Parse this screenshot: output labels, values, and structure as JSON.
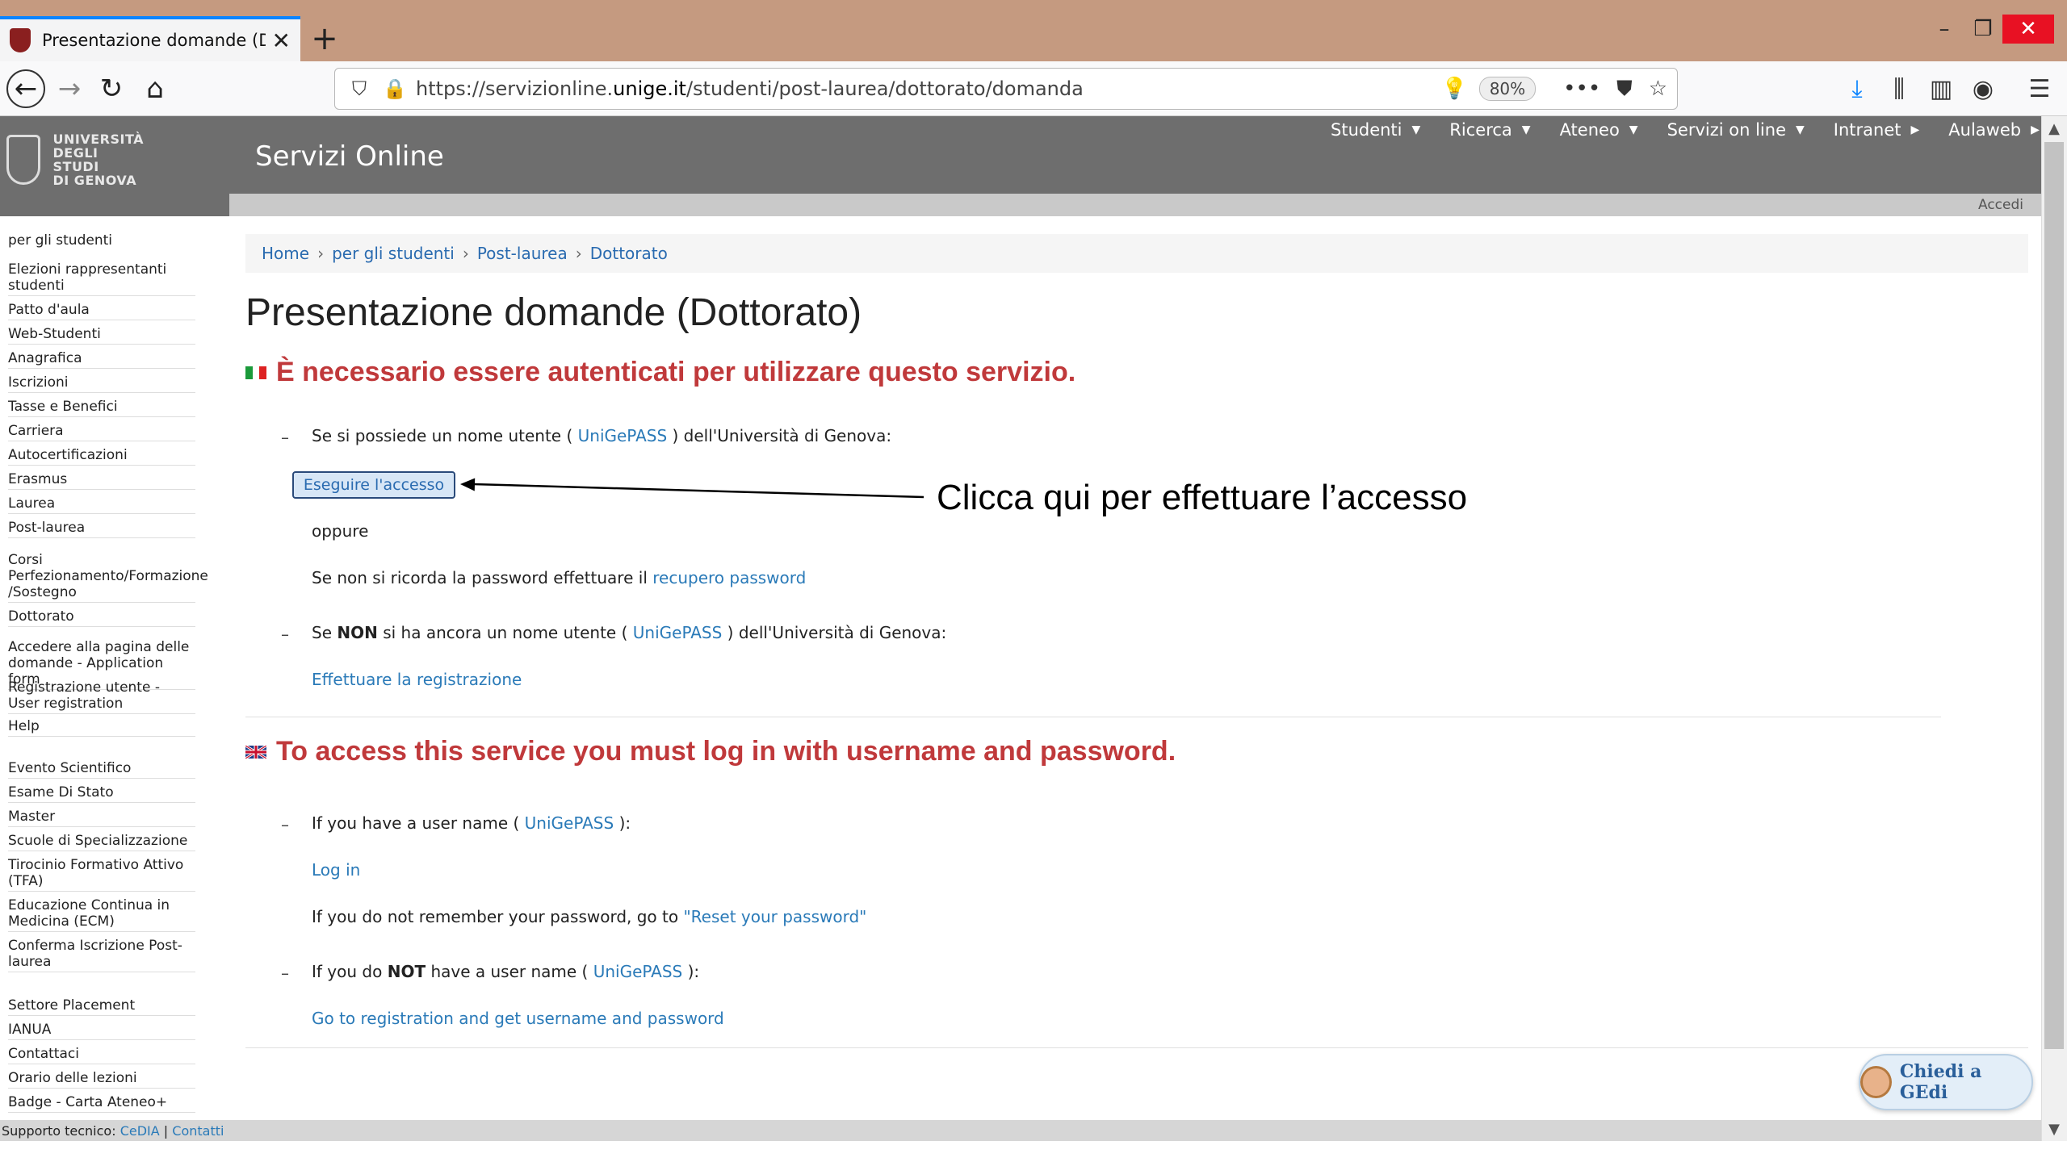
{
  "browser": {
    "tab_title": "Presentazione domande (Dotto",
    "url_prefix": "https://servizionline.",
    "url_domain": "unige.it",
    "url_path": "/studenti/post-laurea/dottorato/domanda",
    "zoom": "80%"
  },
  "site": {
    "logo_lines": [
      "UNIVERSITÀ",
      "DEGLI STUDI",
      "DI GENOVA"
    ],
    "name": "Servizi Online",
    "menu": [
      "Studenti",
      "Ricerca",
      "Ateneo",
      "Servizi on line",
      "Intranet",
      "Aulaweb"
    ],
    "accedi": "Accedi"
  },
  "sidebar": {
    "items": [
      "per gli studenti",
      "Elezioni rappresentanti studenti",
      "Patto d'aula",
      "Web-Studenti",
      "Anagrafica",
      "Iscrizioni",
      "Tasse e Benefici",
      "Carriera",
      "Autocertificazioni",
      "Erasmus",
      "Laurea",
      "Post-laurea",
      "Corsi Perfezionamento/Formazione /Sostegno",
      "Dottorato",
      "Accedere alla pagina delle domande - Application form",
      "Registrazione utente - User registration",
      "Help",
      "Evento Scientifico",
      "Esame Di Stato",
      "Master",
      "Scuole di Specializzazione",
      "Tirocinio Formativo Attivo (TFA)",
      "Educazione Continua in Medicina (ECM)",
      "Conferma Iscrizione Post-laurea",
      "Settore Placement",
      "IANUA",
      "Contattaci",
      "Orario delle lezioni",
      "Badge - Carta Ateneo+"
    ]
  },
  "breadcrumb": [
    "Home",
    "per gli studenti",
    "Post-laurea",
    "Dottorato"
  ],
  "main": {
    "title": "Presentazione domande (Dottorato)",
    "it": {
      "warning": "È necessario essere autenticati per utilizzare questo servizio.",
      "has_user_pre": "Se si possiede un nome utente (",
      "unigepass": "UniGePASS",
      "has_user_post": ") dell'Università di Genova:",
      "login_button": "Eseguire l'accesso",
      "oppure": "oppure",
      "forgot_pre": "Se non si ricorda la password effettuare il",
      "forgot_link": "recupero password",
      "no_user_pre": "Se",
      "no_user_bold": "NON",
      "no_user_mid": "si ha ancora un nome utente (",
      "no_user_post": ") dell'Università di Genova:",
      "register_link": "Effettuare la registrazione"
    },
    "en": {
      "warning": "To access this service you must log in with username and password.",
      "has_user_pre": "If you have a user name (",
      "has_user_post": "):",
      "login_link": "Log in",
      "forgot_pre": "If you do not remember your password, go to",
      "forgot_link": "\"Reset your password\"",
      "no_user_pre": "If you do",
      "no_user_bold": "NOT",
      "no_user_mid": "have a user name (",
      "no_user_post": "):",
      "register_link": "Go to registration and get username and password"
    }
  },
  "annotation": "Clicca qui per effettuare l’accesso",
  "footer": {
    "label": "Supporto tecnico:",
    "cedia": "CeDIA",
    "sep": "|",
    "contatti": "Contatti"
  },
  "chat": {
    "label": "Chiedi a GEdi"
  },
  "colors": {
    "accent": "#c0393b",
    "link": "#2a7ab8",
    "header": "#6e6e6e"
  }
}
